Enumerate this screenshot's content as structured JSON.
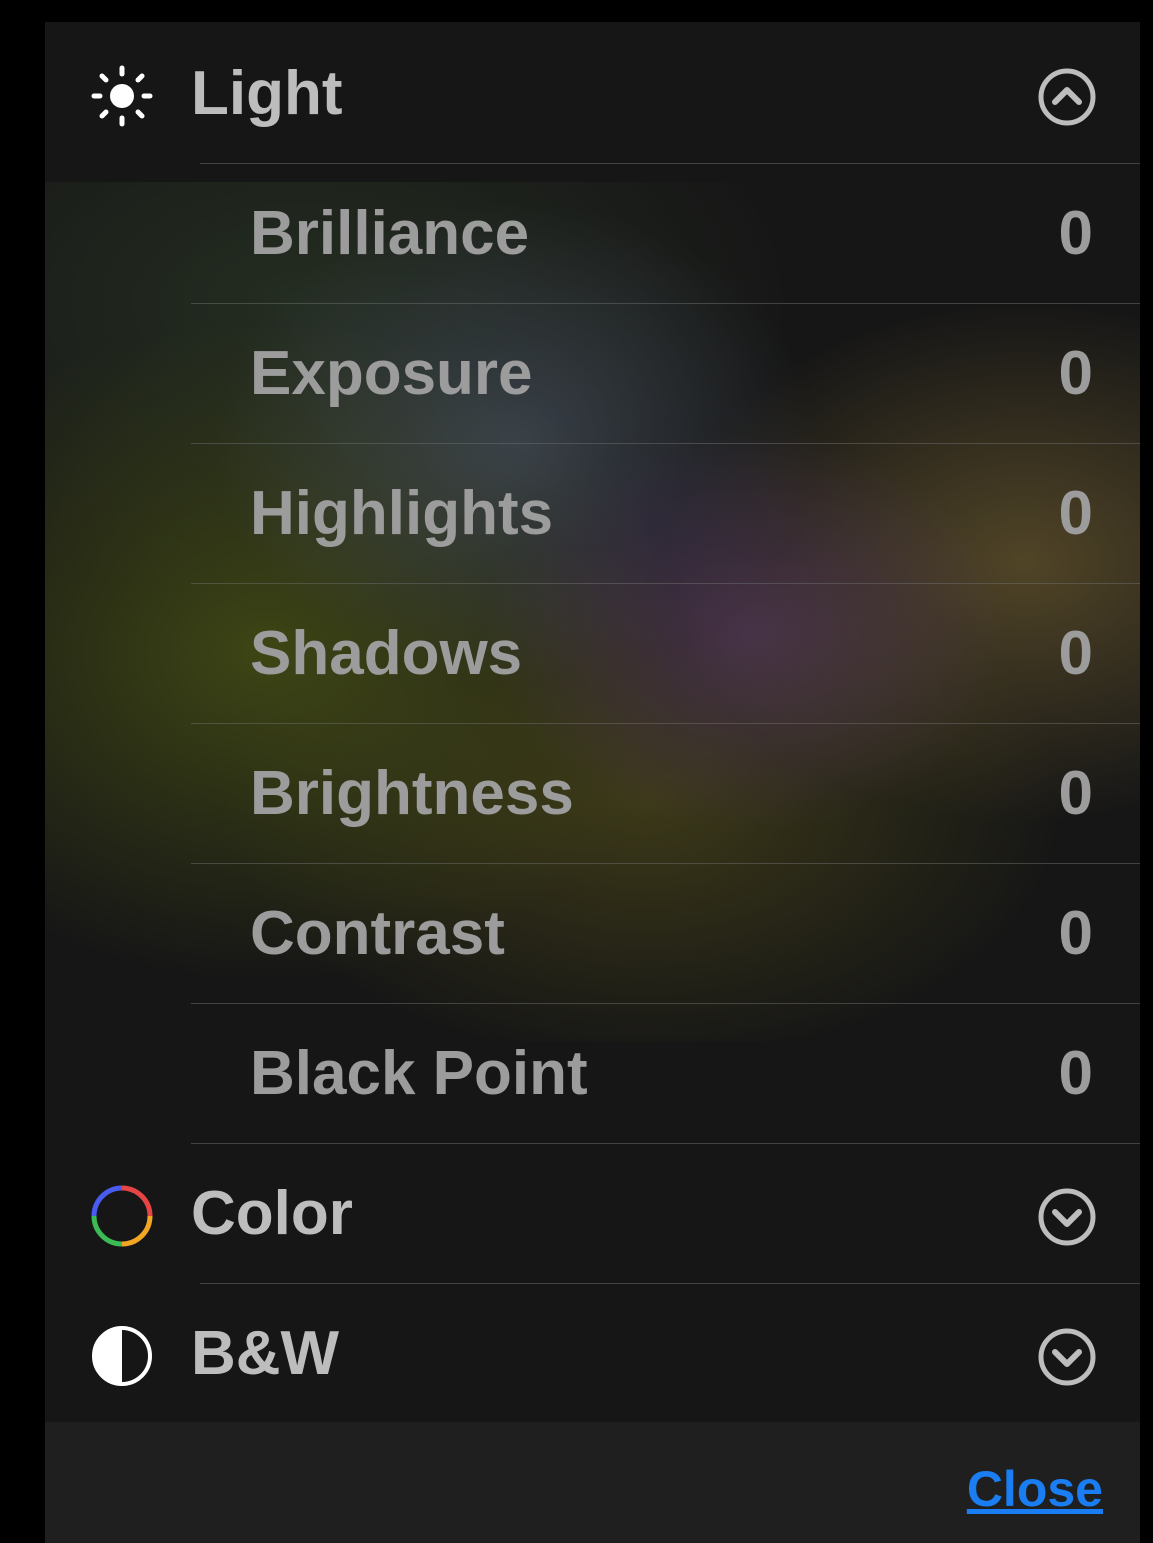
{
  "sections": {
    "light": {
      "label": "Light",
      "icon": "sun-icon",
      "state": "expanded",
      "chevron_icon": "chevron-up-circle-icon",
      "items": [
        {
          "label": "Brilliance",
          "value": "0"
        },
        {
          "label": "Exposure",
          "value": "0"
        },
        {
          "label": "Highlights",
          "value": "0"
        },
        {
          "label": "Shadows",
          "value": "0"
        },
        {
          "label": "Brightness",
          "value": "0"
        },
        {
          "label": "Contrast",
          "value": "0"
        },
        {
          "label": "Black Point",
          "value": "0"
        }
      ]
    },
    "color": {
      "label": "Color",
      "icon": "color-wheel-icon",
      "state": "collapsed",
      "chevron_icon": "chevron-down-circle-icon"
    },
    "bw": {
      "label": "B&W",
      "icon": "half-circle-contrast-icon",
      "state": "collapsed",
      "chevron_icon": "chevron-down-circle-icon"
    }
  },
  "footer": {
    "close_label": "Close"
  },
  "colors": {
    "panel_background": "#161616",
    "footer_background": "#1f1f1f",
    "text": "#9c9c9c",
    "accent_link": "#1a7ef2"
  }
}
